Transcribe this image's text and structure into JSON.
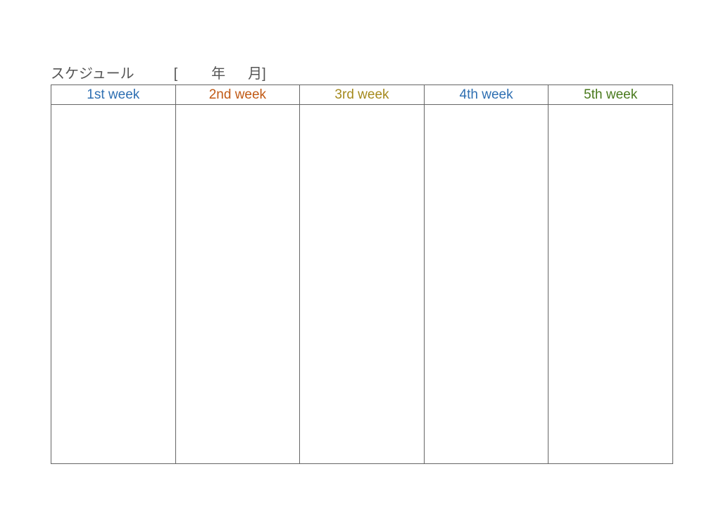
{
  "header": {
    "title": "スケジュール",
    "bracket_open": "[",
    "year_label": "年",
    "month_and_close": "月]"
  },
  "weeks": [
    {
      "label": "1st week",
      "color": "#2e6fb2"
    },
    {
      "label": "2nd week",
      "color": "#c15a15"
    },
    {
      "label": "3rd week",
      "color": "#a58a1e"
    },
    {
      "label": "4th week",
      "color": "#2e6fb2"
    },
    {
      "label": "5th week",
      "color": "#4a7a1e"
    }
  ]
}
